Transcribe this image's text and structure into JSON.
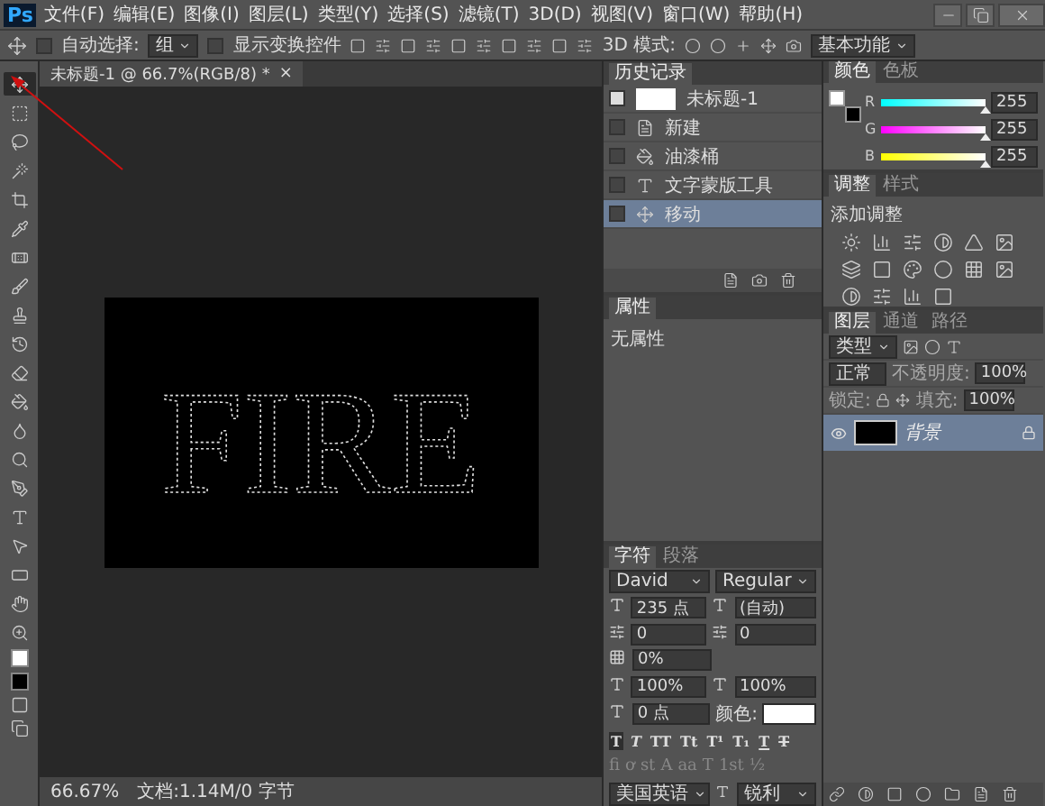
{
  "app": {
    "logo": "Ps",
    "menu": [
      "文件(F)",
      "编辑(E)",
      "图像(I)",
      "图层(L)",
      "类型(Y)",
      "选择(S)",
      "滤镜(T)",
      "3D(D)",
      "视图(V)",
      "窗口(W)",
      "帮助(H)"
    ]
  },
  "options_bar": {
    "auto_select": {
      "label": "自动选择:",
      "checked": false
    },
    "auto_select_target": "组",
    "show_transform": {
      "label": "显示变换控件",
      "checked": false
    },
    "mode_3d_label": "3D 模式:",
    "workspace": "基本功能"
  },
  "toolbar": {
    "tools": [
      {
        "kind": "move",
        "selected": true
      },
      {
        "kind": "marquee",
        "selected": false
      },
      {
        "kind": "lasso",
        "selected": false
      },
      {
        "kind": "wand",
        "selected": false
      },
      {
        "kind": "crop",
        "selected": false
      },
      {
        "kind": "eyedropper",
        "selected": false
      },
      {
        "kind": "healing",
        "selected": false
      },
      {
        "kind": "brush",
        "selected": false
      },
      {
        "kind": "stamp",
        "selected": false
      },
      {
        "kind": "history",
        "selected": false
      },
      {
        "kind": "eraser",
        "selected": false
      },
      {
        "kind": "bucket",
        "selected": false
      },
      {
        "kind": "blur",
        "selected": false
      },
      {
        "kind": "dodge",
        "selected": false
      },
      {
        "kind": "pen",
        "selected": false
      },
      {
        "kind": "type",
        "selected": false
      },
      {
        "kind": "path",
        "selected": false
      },
      {
        "kind": "shape",
        "selected": false
      },
      {
        "kind": "hand",
        "selected": false
      },
      {
        "kind": "zoom",
        "selected": false
      }
    ]
  },
  "document": {
    "tab_title": "未标题-1 @ 66.7%(RGB/8) *",
    "close": "×",
    "canvas_text": "FIRE"
  },
  "status_bar": {
    "zoom": "66.67%",
    "doc_info": "文档:1.14M/0 字节"
  },
  "history": {
    "tabs": [
      {
        "label": "历史记录",
        "selected": true
      }
    ],
    "snapshot": {
      "label": "未标题-1",
      "checked": true
    },
    "items": [
      {
        "label": "新建",
        "kind": "new",
        "selected": false
      },
      {
        "label": "油漆桶",
        "kind": "bucket",
        "selected": false
      },
      {
        "label": "文字蒙版工具",
        "kind": "type",
        "selected": false
      },
      {
        "label": "移动",
        "kind": "move",
        "selected": true
      }
    ]
  },
  "properties": {
    "tabs": [
      {
        "label": "属性",
        "selected": true
      }
    ],
    "message": "无属性"
  },
  "character": {
    "tabs": [
      {
        "label": "字符",
        "selected": true
      },
      {
        "label": "段落",
        "selected": false
      }
    ],
    "font_family": "David",
    "font_style": "Regular",
    "size": "235 点",
    "leading": "(自动)",
    "kerning": "0",
    "tracking": "0",
    "tsume": "0%",
    "vertical_scale": "100%",
    "horizontal_scale": "100%",
    "baseline_shift": "0 点",
    "color_label": "颜色:",
    "style_buttons": [
      {
        "label": "T",
        "kind": "bold",
        "selected": true
      },
      {
        "label": "T",
        "kind": "italic",
        "selected": false
      },
      {
        "label": "TT",
        "kind": "caps",
        "selected": false
      },
      {
        "label": "Tt",
        "kind": "smallcaps",
        "selected": false
      },
      {
        "label": "T¹",
        "kind": "super",
        "selected": false
      },
      {
        "label": "T₁",
        "kind": "sub",
        "selected": false
      },
      {
        "label": "T",
        "kind": "underline",
        "selected": false
      },
      {
        "label": "T",
        "kind": "strike",
        "selected": false
      }
    ],
    "opentype_buttons": [
      {
        "label": "fi",
        "disabled": true
      },
      {
        "label": "ơ",
        "disabled": true
      },
      {
        "label": "st",
        "disabled": true
      },
      {
        "label": "A",
        "disabled": true
      },
      {
        "label": "aa",
        "disabled": true
      },
      {
        "label": "T",
        "disabled": true
      },
      {
        "label": "1st",
        "disabled": true
      },
      {
        "label": "½",
        "disabled": true
      }
    ],
    "language": "美国英语",
    "antialias": "锐利"
  },
  "color": {
    "tabs": [
      {
        "label": "颜色",
        "selected": true
      },
      {
        "label": "色板",
        "selected": false
      }
    ],
    "channels": [
      {
        "name": "R",
        "level": 1,
        "value": "255"
      },
      {
        "name": "G",
        "level": 1,
        "value": "255"
      },
      {
        "name": "B",
        "level": 1,
        "value": "255"
      }
    ]
  },
  "adjustments": {
    "tabs": [
      {
        "label": "调整",
        "selected": true
      },
      {
        "label": "样式",
        "selected": false
      }
    ],
    "title": "添加调整"
  },
  "layers": {
    "tabs": [
      {
        "label": "图层",
        "selected": true
      },
      {
        "label": "通道",
        "selected": false
      },
      {
        "label": "路径",
        "selected": false
      }
    ],
    "filter_kind": "类型",
    "blend_mode": "正常",
    "opacity_label": "不透明度:",
    "opacity": "100%",
    "lock_label": "锁定:",
    "fill_label": "填充:",
    "fill": "100%",
    "items": [
      {
        "name": "背景",
        "visible": true,
        "locked": true,
        "selected": true
      }
    ]
  }
}
